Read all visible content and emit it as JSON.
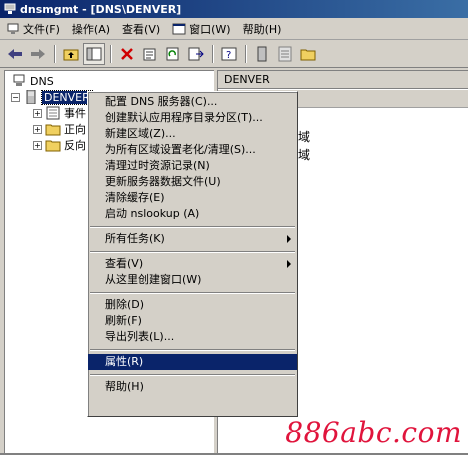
{
  "window": {
    "title": "dnsmgmt - [DNS\\DENVER]"
  },
  "menubar": {
    "items": [
      {
        "label": "文件(F)",
        "icon": "console-icon"
      },
      {
        "label": "操作(A)",
        "icon": ""
      },
      {
        "label": "查看(V)",
        "icon": ""
      },
      {
        "label": "窗口(W)",
        "icon": "window-icon"
      },
      {
        "label": "帮助(H)",
        "icon": ""
      }
    ]
  },
  "toolbar": {
    "buttons": [
      "back-icon",
      "forward-icon",
      "up-folder-icon",
      "show-tree-icon",
      "delete-icon",
      "properties-icon",
      "refresh-icon",
      "export-icon",
      "help-icon",
      "server-icon",
      "list-icon",
      "folder-icon"
    ]
  },
  "tree": {
    "root": "DNS",
    "server": "DENVER",
    "children": [
      "事件",
      "正向",
      "反向"
    ]
  },
  "detail": {
    "header": "DENVER",
    "rows": [
      "域",
      "域"
    ]
  },
  "context_menu": {
    "groups": [
      [
        {
          "label": "配置 DNS 服务器(C)..."
        },
        {
          "label": "创建默认应用程序目录分区(T)..."
        },
        {
          "label": "新建区域(Z)..."
        },
        {
          "label": "为所有区域设置老化/清理(S)..."
        },
        {
          "label": "清理过时资源记录(N)"
        },
        {
          "label": "更新服务器数据文件(U)"
        },
        {
          "label": "清除缓存(E)"
        },
        {
          "label": "启动 nslookup (A)"
        }
      ],
      [
        {
          "label": "所有任务(K)",
          "submenu": true
        }
      ],
      [
        {
          "label": "查看(V)",
          "submenu": true
        },
        {
          "label": "从这里创建窗口(W)"
        }
      ],
      [
        {
          "label": "删除(D)"
        },
        {
          "label": "刷新(F)"
        },
        {
          "label": "导出列表(L)..."
        }
      ],
      [
        {
          "label": "属性(R)",
          "highlight": true
        }
      ],
      [
        {
          "label": "帮助(H)"
        }
      ]
    ]
  },
  "watermark": "886abc.com",
  "colors": {
    "highlight": "#0a246a",
    "face": "#d4d0c8",
    "watermark": "#e0143c"
  }
}
